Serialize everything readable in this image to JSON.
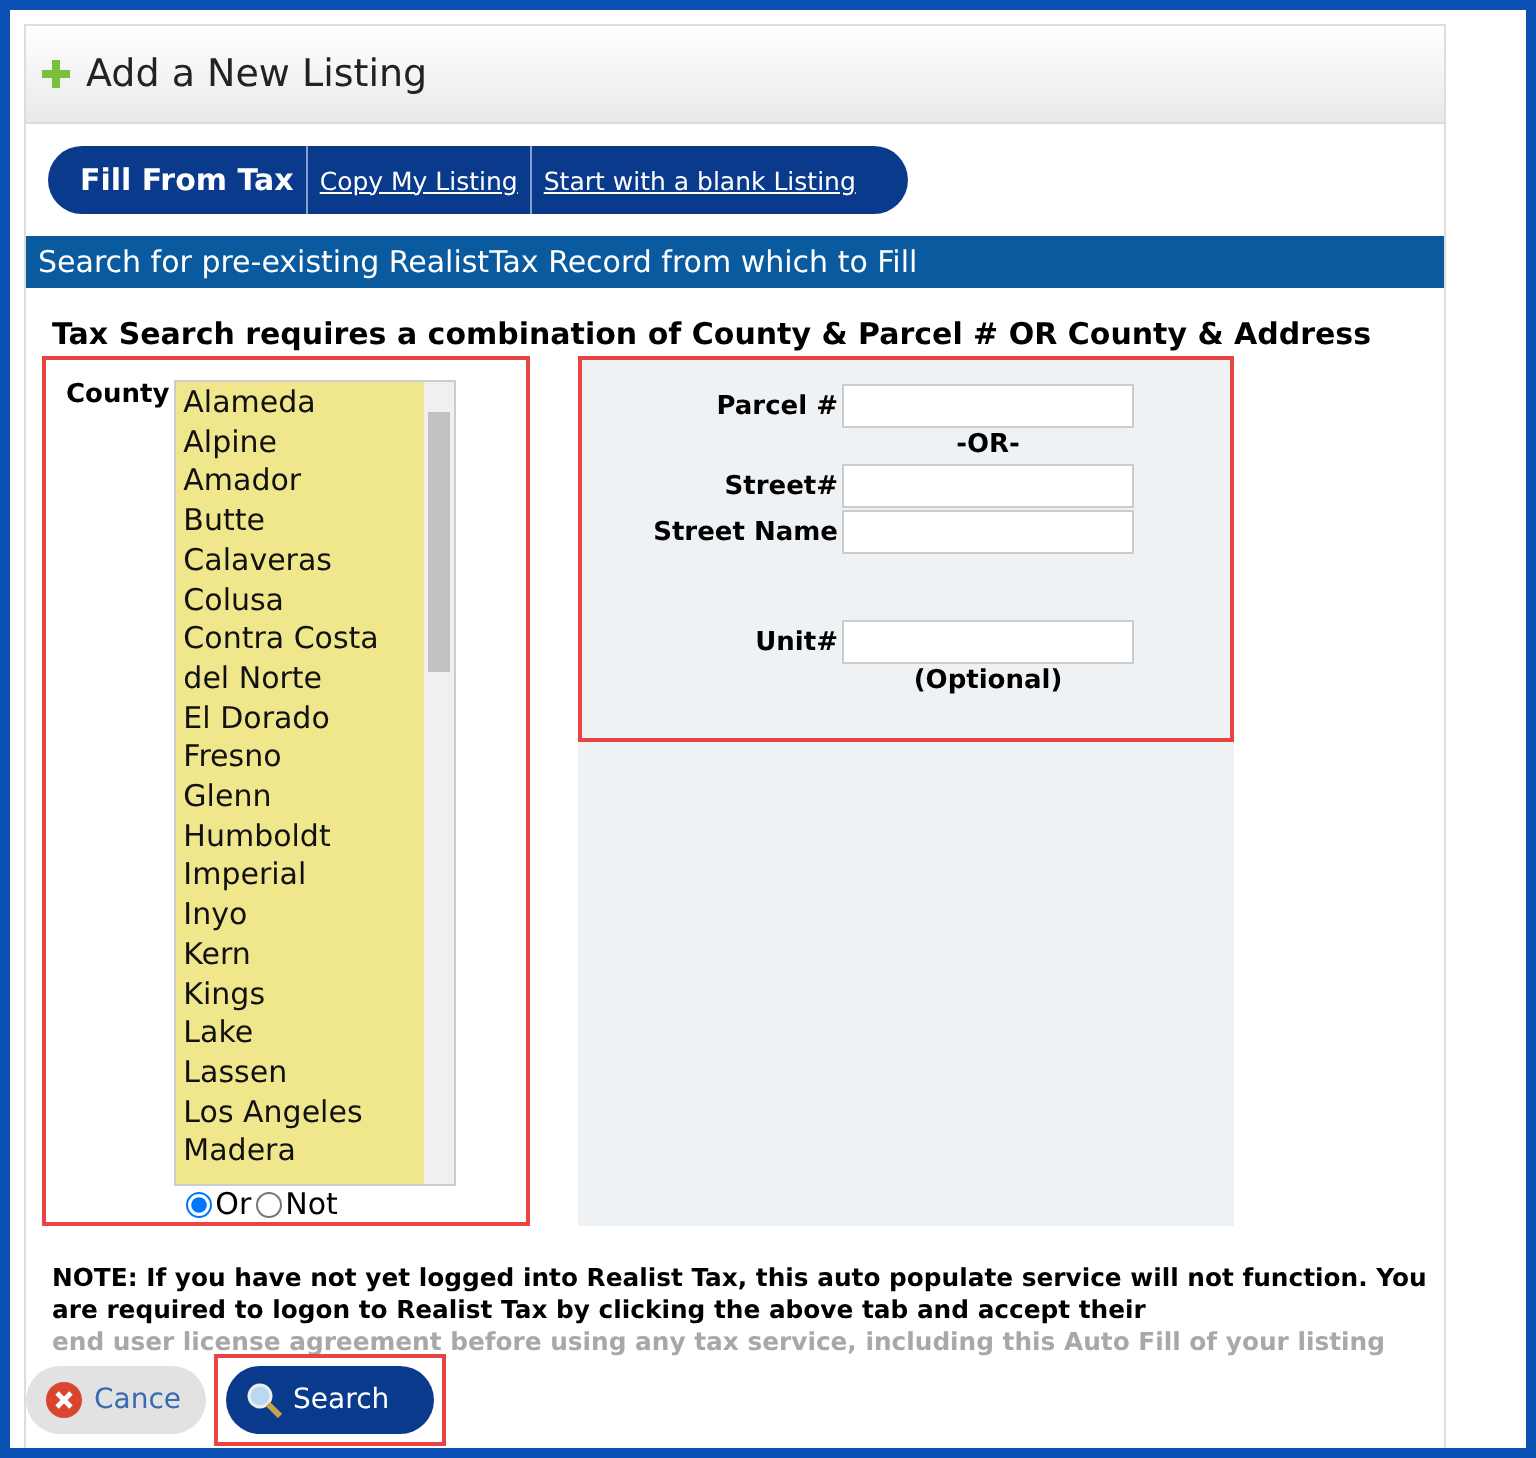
{
  "header": {
    "title": "Add a New Listing"
  },
  "tabs": [
    {
      "label": "Fill From Tax",
      "selected": true
    },
    {
      "label": "Copy My Listing",
      "selected": false
    },
    {
      "label": "Start with a blank Listing",
      "selected": false
    }
  ],
  "section_bar": "Search for pre-existing RealistTax Record from which to Fill",
  "instruction": "Tax Search requires a combination of County & Parcel # OR County & Address",
  "county": {
    "label": "County",
    "options": [
      {
        "label": "Alameda",
        "selected": false
      },
      {
        "label": "Alpine",
        "selected": false
      },
      {
        "label": "Amador",
        "selected": false
      },
      {
        "label": "Butte",
        "selected": false
      },
      {
        "label": "Calaveras",
        "selected": false
      },
      {
        "label": "Colusa",
        "selected": false
      },
      {
        "label": "Contra Costa",
        "selected": false
      },
      {
        "label": "del Norte",
        "selected": false
      },
      {
        "label": "El Dorado",
        "selected": false
      },
      {
        "label": "Fresno",
        "selected": false
      },
      {
        "label": "Glenn",
        "selected": false
      },
      {
        "label": "Humboldt",
        "selected": false
      },
      {
        "label": "Imperial",
        "selected": false
      },
      {
        "label": "Inyo",
        "selected": false
      },
      {
        "label": "Kern",
        "selected": false
      },
      {
        "label": "Kings",
        "selected": false
      },
      {
        "label": "Lake",
        "selected": false
      },
      {
        "label": "Lassen",
        "selected": false
      },
      {
        "label": "Los Angeles",
        "selected": false
      },
      {
        "label": "Madera",
        "selected": false
      }
    ],
    "modes": [
      {
        "label": "Or",
        "selected": true
      },
      {
        "label": "Not",
        "selected": false
      }
    ]
  },
  "fields": [
    {
      "label": "Parcel #",
      "note": "-OR-"
    },
    {
      "label": "Street#"
    },
    {
      "label": "Street Name"
    }
  ],
  "unit_field": {
    "label": "Unit#",
    "note": "(Optional)"
  },
  "note": [
    "NOTE:  If you have not yet logged into Realist Tax, this auto populate service will not function. You are required to logon to Realist Tax by clicking the above tab and accept their"
  ],
  "faded_note": "end user license agreement before using any tax service, including this Auto Fill of your listing",
  "buttons": [
    {
      "label": "Cance",
      "kind": "cancel"
    },
    {
      "label": "Search",
      "kind": "search"
    }
  ]
}
